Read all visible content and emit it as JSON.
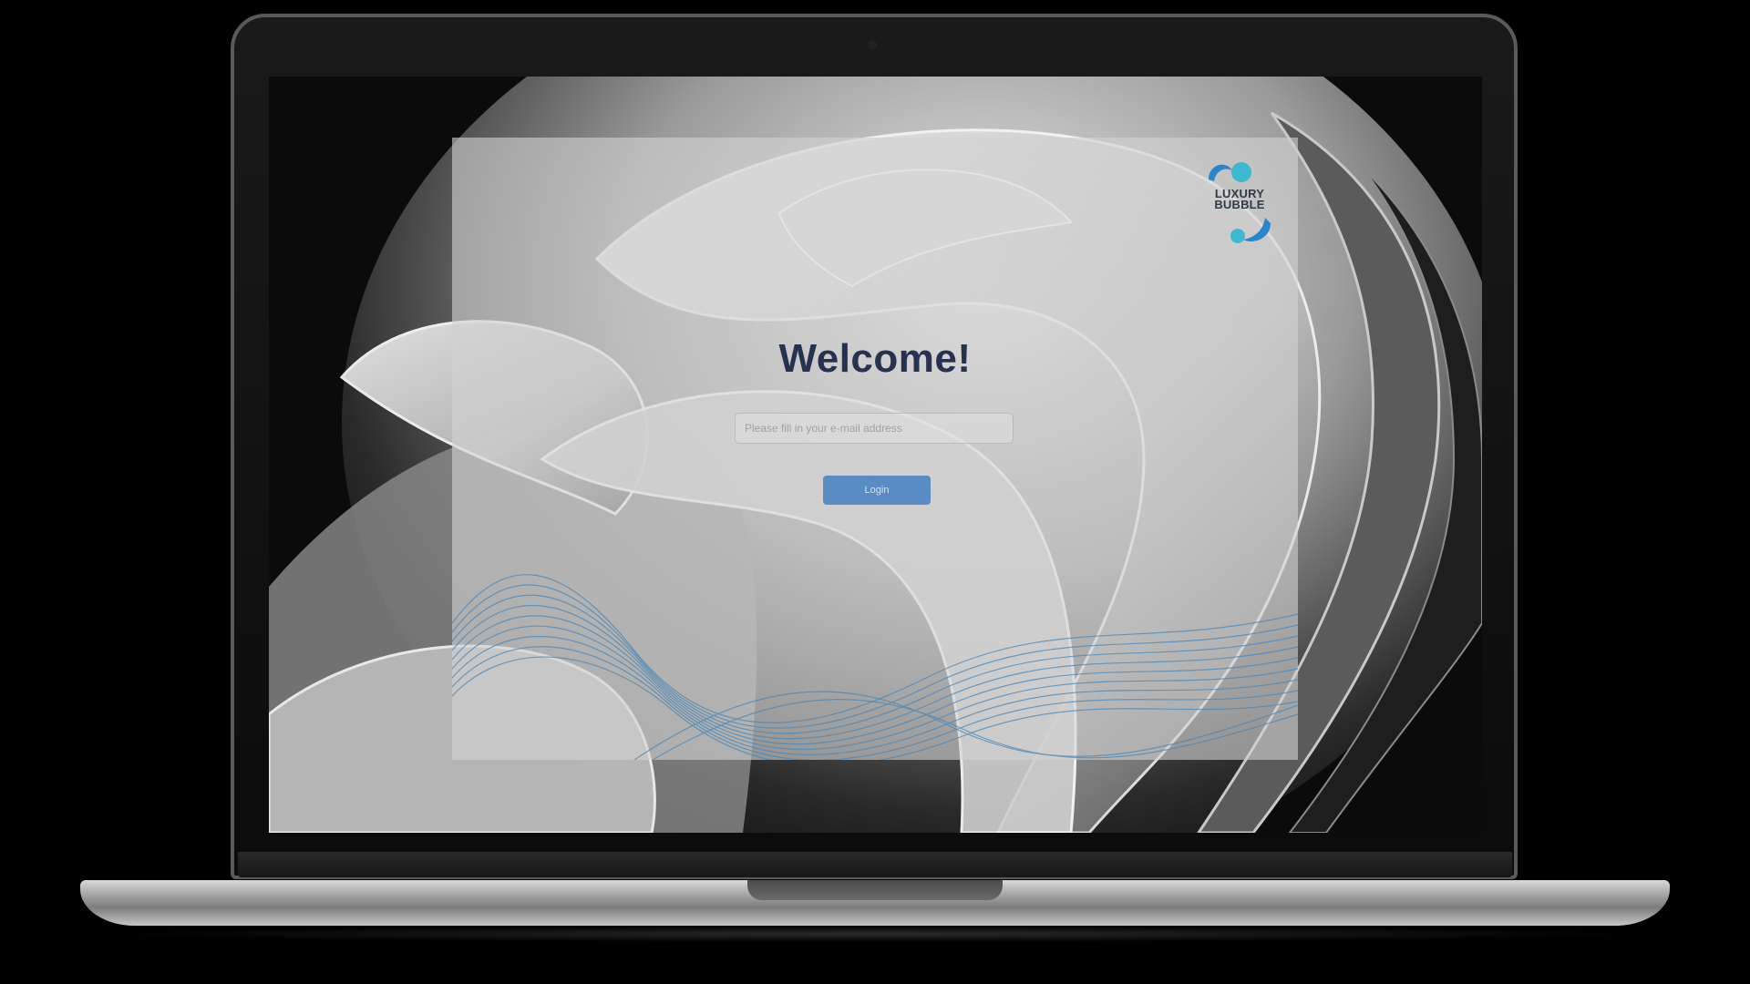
{
  "login": {
    "title": "Welcome!",
    "email_placeholder": "Please fill in your e-mail address",
    "email_value": "",
    "button_label": "Login"
  },
  "logo": {
    "line1": "LUXURY",
    "line2": "BUBBLE"
  },
  "colors": {
    "title": "#26324f",
    "button": "#5a8bc3",
    "logo_blue": "#2a86c8",
    "logo_teal": "#3fb7cf",
    "wave_lines": "#4a86b6"
  },
  "icons": [
    "luxury-bubble-logo"
  ]
}
